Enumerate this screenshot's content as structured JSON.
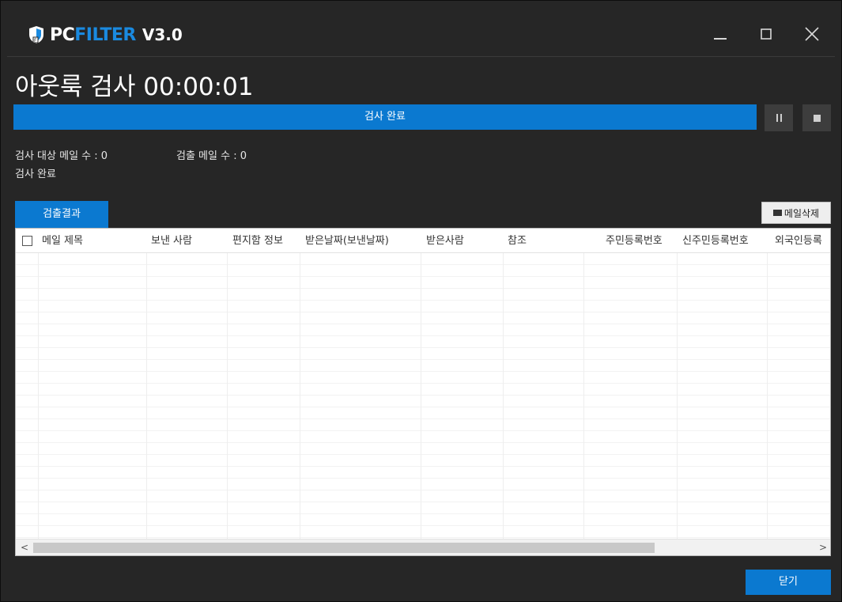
{
  "app": {
    "logo_pc": "PC",
    "logo_filter": "FILTER",
    "version": "V3.0"
  },
  "window_controls": {
    "minimize_icon": "minimize-icon",
    "maximize_icon": "maximize-icon",
    "close_icon": "close-icon"
  },
  "heading": "아웃룩 검사 00:00:01",
  "progress": {
    "label": "검사 완료",
    "fraction": 1.0,
    "pause_icon": "pause-icon",
    "stop_icon": "stop-icon"
  },
  "status": {
    "target_count": "검사 대상 메일 수 : 0",
    "detected_count": "검출 메일 수 : 0",
    "state": "검사 완료"
  },
  "tabs": [
    "검출결과"
  ],
  "delete_button": "메일삭제",
  "table": {
    "columns": [
      "메일 제목",
      "보낸 사람",
      "편지함 정보",
      "받은날짜(보낸날짜)",
      "받은사람",
      "참조",
      "주민등록번호",
      "신주민등록번호",
      "외국인등록"
    ],
    "rows": []
  },
  "close_button": "닫기",
  "colors": {
    "accent": "#0b79d0",
    "background": "#262626",
    "logo_blue": "#1a8ae0"
  }
}
